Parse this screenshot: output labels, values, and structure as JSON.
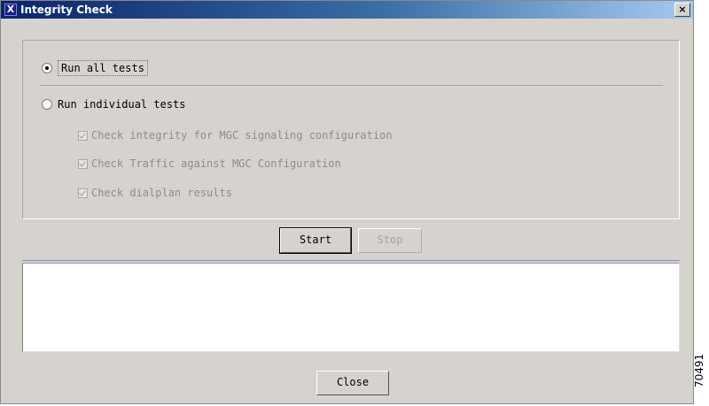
{
  "window": {
    "title": "Integrity Check",
    "icon_glyph": "X",
    "close_glyph": "×"
  },
  "tests": {
    "run_all_label": "Run all tests",
    "run_all_selected": true,
    "run_individual_label": "Run individual tests",
    "run_individual_selected": false,
    "checks": [
      {
        "label": "Check integrity for MGC signaling configuration",
        "checked": true,
        "enabled": false
      },
      {
        "label": "Check Traffic against MGC Configuration",
        "checked": true,
        "enabled": false
      },
      {
        "label": "Check dialplan results",
        "checked": true,
        "enabled": false
      }
    ]
  },
  "actions": {
    "start_label": "Start",
    "stop_label": "Stop",
    "stop_enabled": false
  },
  "results": {
    "text": ""
  },
  "footer": {
    "close_label": "Close"
  },
  "figure_id": "70491",
  "colors": {
    "title_gradient_start": "#0a246a",
    "title_gradient_end": "#a6caf0",
    "window_bg": "#d6d3ce",
    "disabled_text": "#8e8c88"
  }
}
